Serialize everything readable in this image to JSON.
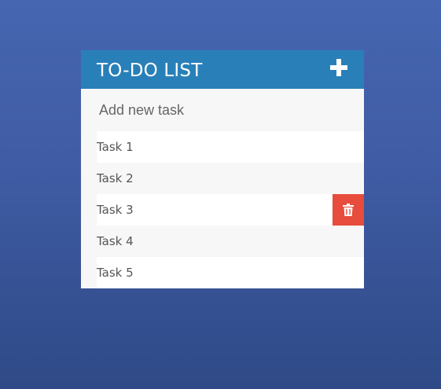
{
  "header": {
    "title": "TO-DO LIST",
    "add_icon": "plus-icon"
  },
  "new_task": {
    "placeholder": "Add new task",
    "value": ""
  },
  "tasks": [
    {
      "label": "Task 1",
      "hovered": false
    },
    {
      "label": "Task 2",
      "hovered": false
    },
    {
      "label": "Task 3",
      "hovered": true
    },
    {
      "label": "Task 4",
      "hovered": false
    },
    {
      "label": "Task 5",
      "hovered": false
    }
  ],
  "delete_icon": "trash-icon",
  "colors": {
    "header_bg": "#2980b9",
    "delete_bg": "#e74c3c",
    "background_top": "#4666b1",
    "background_bottom": "#2f4a86"
  }
}
